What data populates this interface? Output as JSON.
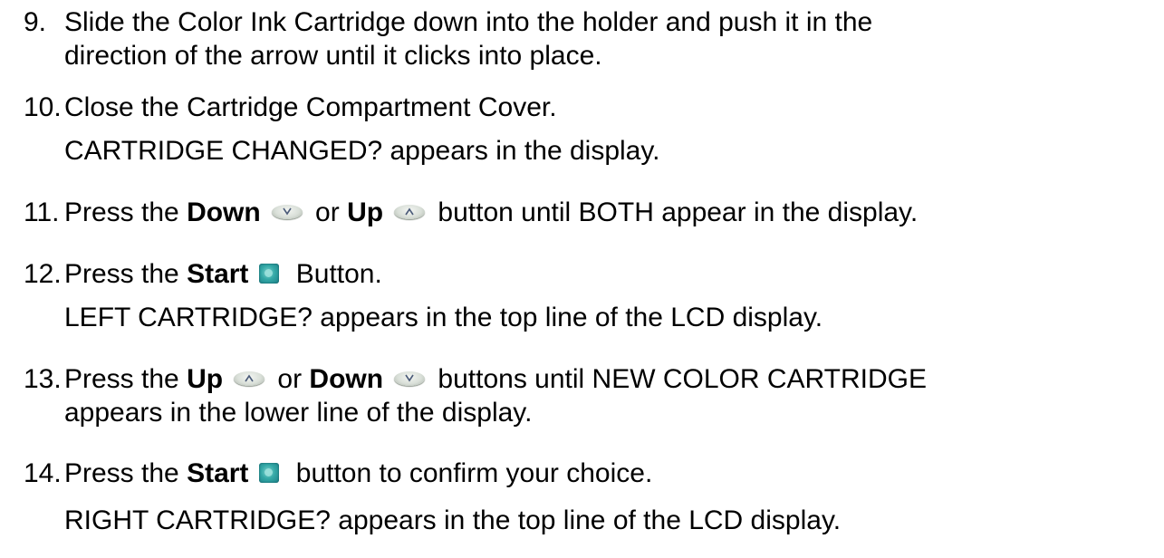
{
  "steps": [
    {
      "num": "9.",
      "lines": [
        "Slide the Color Ink Cartridge down into the holder and push it in the",
        "direction of the arrow until it clicks into place."
      ]
    },
    {
      "num": "10.",
      "text": "Close the Cartridge Compartment Cover.",
      "note": "CARTRIDGE CHANGED? appears in the display."
    },
    {
      "num": "11.",
      "pre": "Press the ",
      "b1": "Down",
      "icon1": "down-arrow-button-icon",
      "mid": " or ",
      "b2": "Up",
      "icon2": "up-arrow-button-icon",
      "post": " button until BOTH appear in the display."
    },
    {
      "num": "12.",
      "pre": "Press the ",
      "b1": "Start",
      "icon1": "start-button-icon",
      "post": " Button.",
      "note": "LEFT CARTRIDGE? appears in the top line of the LCD display."
    },
    {
      "num": "13.",
      "pre": "Press the ",
      "b1": "Up",
      "icon1": "up-arrow-button-icon",
      "mid": " or ",
      "b2": "Down",
      "icon2": "down-arrow-button-icon",
      "post": " buttons until NEW COLOR CARTRIDGE",
      "line2": "appears in the lower line of the display."
    },
    {
      "num": "14.",
      "pre": "Press the ",
      "b1": "Start",
      "icon1": "start-button-icon",
      "post": " button to confirm your choice.",
      "note": "RIGHT CARTRIDGE? appears in the top line of the LCD display."
    }
  ],
  "colors": {
    "text": "#000000",
    "arrow_button": "#d9dfd8",
    "start_button": "#33a8a6"
  }
}
